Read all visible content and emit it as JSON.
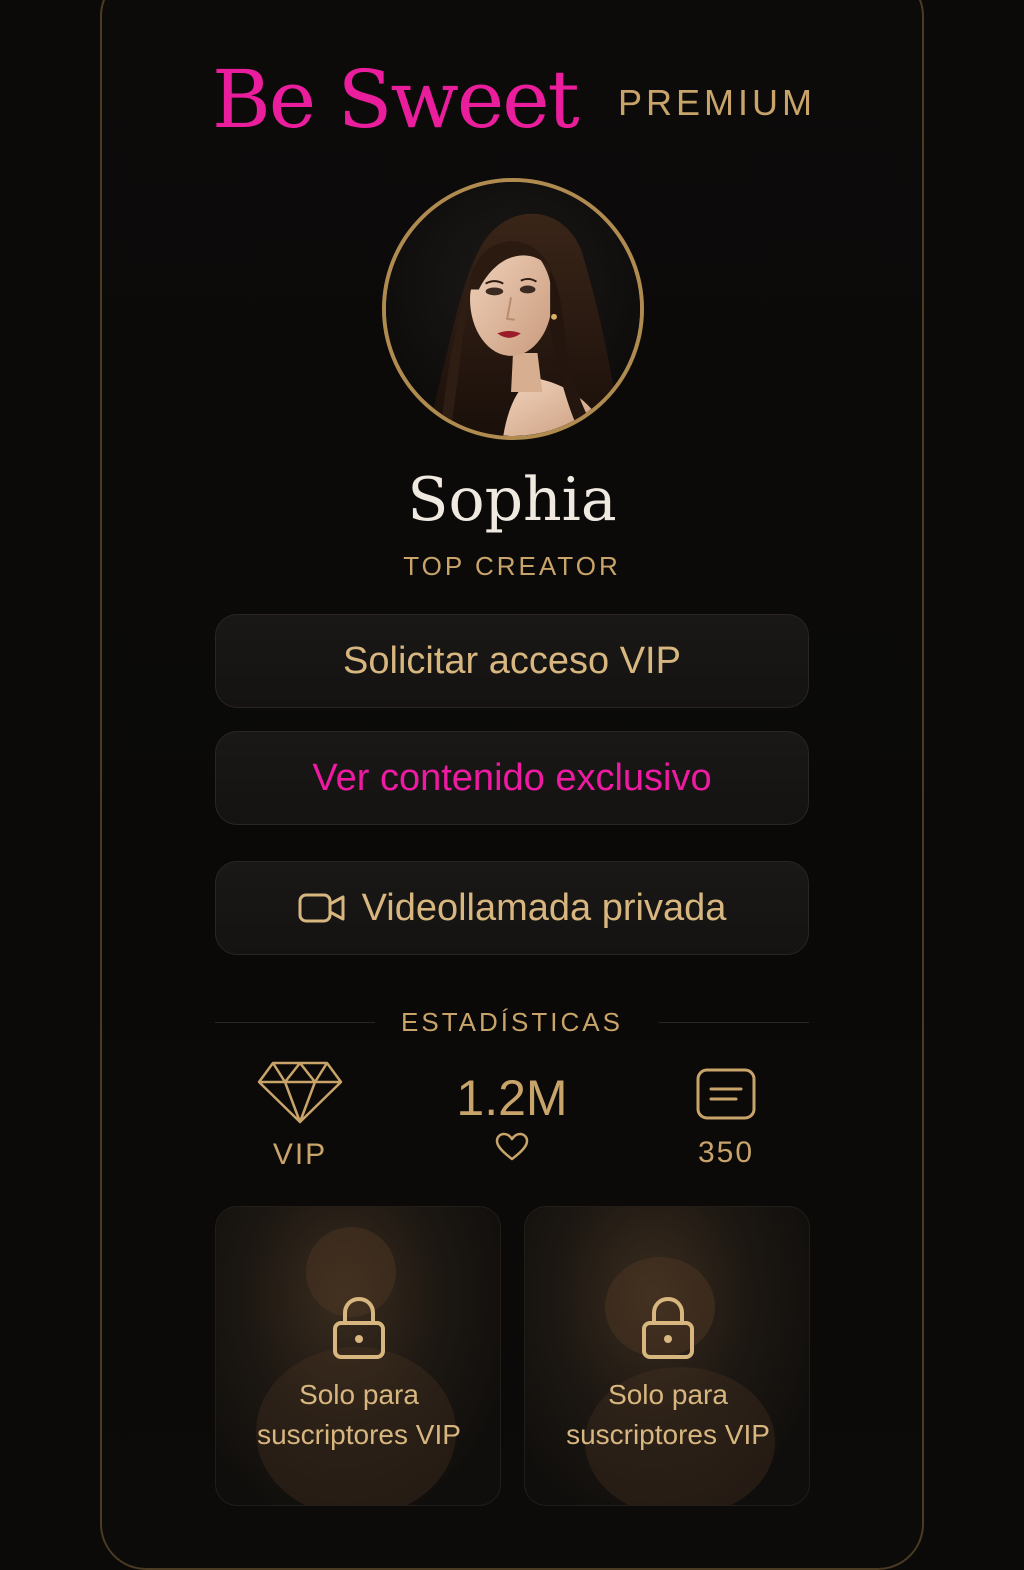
{
  "header": {
    "brand": "Be Sweet",
    "badge": "PREMIUM"
  },
  "profile": {
    "name": "Sophia",
    "role": "TOP CREATOR"
  },
  "actions": {
    "vip_access": "Solicitar acceso VIP",
    "exclusive": "Ver contenido exclusivo",
    "video_call": "Videollamada privada"
  },
  "stats": {
    "heading": "ESTADÍSTICAS",
    "vip_label": "VIP",
    "likes": "1.2M",
    "posts": "350"
  },
  "locked_content": [
    {
      "line1": "Solo para",
      "line2": "suscriptores VIP"
    },
    {
      "line1": "Solo para",
      "line2": "suscriptores VIP"
    }
  ],
  "colors": {
    "brand_pink": "#ea1e9c",
    "gold": "#c9a46a",
    "background": "#0b0a09"
  },
  "icons": [
    "video-camera-icon",
    "diamond-icon",
    "heart-icon",
    "posts-icon",
    "lock-icon"
  ]
}
